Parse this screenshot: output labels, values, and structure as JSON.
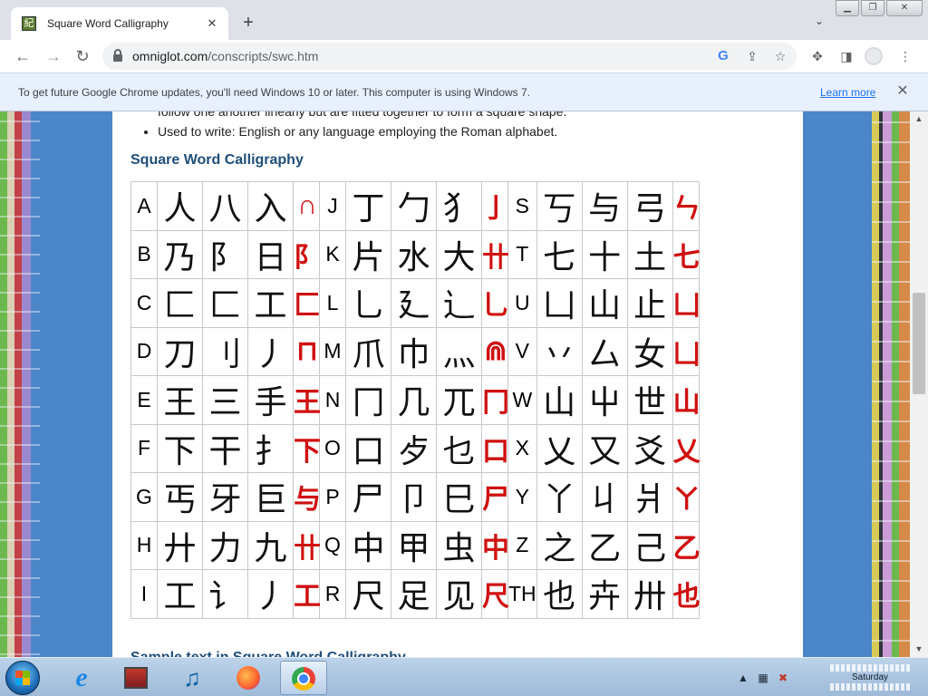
{
  "browser": {
    "tab_title": "Square Word Calligraphy",
    "tab_favicon": "紀",
    "new_tab_label": "+",
    "url_host": "omniglot.com",
    "url_path": "/conscripts/swc.htm"
  },
  "infobar": {
    "message": "To get future Google Chrome updates, you'll need Windows 10 or later. This computer is using Windows 7.",
    "link": "Learn more"
  },
  "page": {
    "bullet_cut": "follow one another linearly but are fitted together to form a square shape.",
    "bullet_used_to_write": "Used to write: English or any language employing the Roman alphabet.",
    "section_title": "Square Word Calligraphy",
    "next_section_title": "Sample text in Square Word Calligraphy"
  },
  "swc_table": {
    "rows": [
      [
        {
          "l": "A",
          "c": [
            "人",
            "八",
            "入"
          ],
          "s": "∩"
        },
        {
          "l": "J",
          "c": [
            "丁",
            "勹",
            "犭"
          ],
          "s": "亅"
        },
        {
          "l": "S",
          "c": [
            "丂",
            "与",
            "弓"
          ],
          "s": "ㄣ"
        }
      ],
      [
        {
          "l": "B",
          "c": [
            "乃",
            "阝",
            "日"
          ],
          "s": "阝"
        },
        {
          "l": "K",
          "c": [
            "片",
            "水",
            "大"
          ],
          "s": "卄"
        },
        {
          "l": "T",
          "c": [
            "七",
            "十",
            "土"
          ],
          "s": "七"
        }
      ],
      [
        {
          "l": "C",
          "c": [
            "匚",
            "匚",
            "工"
          ],
          "s": "匚"
        },
        {
          "l": "L",
          "c": [
            "乚",
            "廴",
            "辶"
          ],
          "s": "乚"
        },
        {
          "l": "U",
          "c": [
            "凵",
            "山",
            "止"
          ],
          "s": "凵"
        }
      ],
      [
        {
          "l": "D",
          "c": [
            "刀",
            "刂",
            "丿"
          ],
          "s": "⊓"
        },
        {
          "l": "M",
          "c": [
            "爪",
            "巾",
            "灬"
          ],
          "s": "⋒"
        },
        {
          "l": "V",
          "c": [
            "丷",
            "厶",
            "女"
          ],
          "s": "凵"
        }
      ],
      [
        {
          "l": "E",
          "c": [
            "王",
            "三",
            "手"
          ],
          "s": "王"
        },
        {
          "l": "N",
          "c": [
            "冂",
            "几",
            "兀"
          ],
          "s": "冂"
        },
        {
          "l": "W",
          "c": [
            "山",
            "屮",
            "世"
          ],
          "s": "山"
        }
      ],
      [
        {
          "l": "F",
          "c": [
            "下",
            "干",
            "扌"
          ],
          "s": "下"
        },
        {
          "l": "O",
          "c": [
            "口",
            "歺",
            "乜"
          ],
          "s": "口"
        },
        {
          "l": "X",
          "c": [
            "乂",
            "又",
            "爻"
          ],
          "s": "乂"
        }
      ],
      [
        {
          "l": "G",
          "c": [
            "丐",
            "牙",
            "巨"
          ],
          "s": "与"
        },
        {
          "l": "P",
          "c": [
            "尸",
            "卩",
            "巳"
          ],
          "s": "尸"
        },
        {
          "l": "Y",
          "c": [
            "丫",
            "丩",
            "爿"
          ],
          "s": "ㄚ"
        }
      ],
      [
        {
          "l": "H",
          "c": [
            "廾",
            "力",
            "九"
          ],
          "s": "卄"
        },
        {
          "l": "Q",
          "c": [
            "中",
            "甲",
            "虫"
          ],
          "s": "中"
        },
        {
          "l": "Z",
          "c": [
            "之",
            "乙",
            "己"
          ],
          "s": "乙"
        }
      ],
      [
        {
          "l": "I",
          "c": [
            "工",
            "讠",
            "丿"
          ],
          "s": "工"
        },
        {
          "l": "R",
          "c": [
            "尺",
            "足",
            "见"
          ],
          "s": "尺"
        },
        {
          "l": "TH",
          "c": [
            "也",
            "卉",
            "卅"
          ],
          "s": "也"
        }
      ]
    ]
  },
  "taskbar": {
    "clock_day": "Saturday"
  },
  "colors": {
    "accent": "#1a73e8",
    "heading": "#1f4e79",
    "swc_red": "#d01010",
    "page_bg": "#4a86c8"
  }
}
